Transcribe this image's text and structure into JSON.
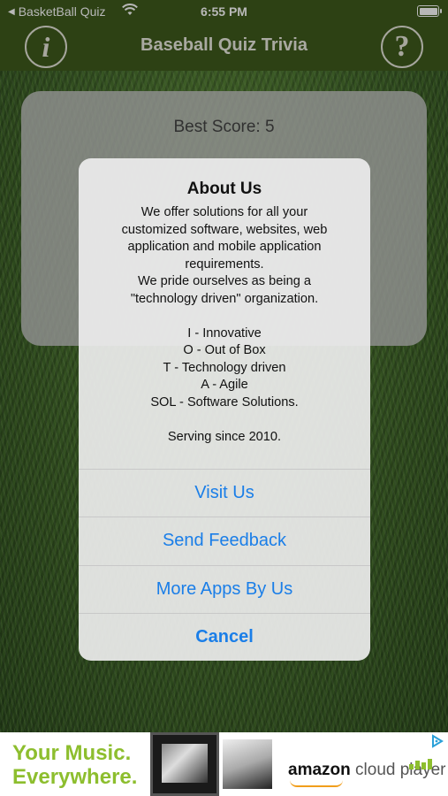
{
  "status_bar": {
    "back_app": "BasketBall Quiz",
    "time": "6:55 PM"
  },
  "nav": {
    "title": "Baseball Quiz Trivia",
    "info_icon": "info-icon",
    "help_icon": "question-icon"
  },
  "score_card": {
    "best_score": "Best Score: 5"
  },
  "alert": {
    "title": "About Us",
    "message_lines": [
      "We offer solutions for all your",
      "customized software, websites, web",
      "application and mobile application",
      "requirements.",
      "We pride ourselves as being a",
      "\"technology driven\" organization.",
      "",
      "I - Innovative",
      "O - Out of Box",
      "T - Technology driven",
      "A - Agile",
      "SOL - Software Solutions.",
      "",
      "Serving since 2010."
    ],
    "actions": [
      {
        "label": "Visit Us"
      },
      {
        "label": "Send Feedback"
      },
      {
        "label": "More Apps By Us"
      },
      {
        "label": "Cancel"
      }
    ]
  },
  "ad": {
    "tagline_line1": "Your Music.",
    "tagline_line2": "Everywhere.",
    "brand": "amazon",
    "product": "cloud player"
  },
  "colors": {
    "nav_bg": "#3f5a1d",
    "action_blue": "#1a7ee8",
    "ad_green": "#8dbe2e"
  }
}
